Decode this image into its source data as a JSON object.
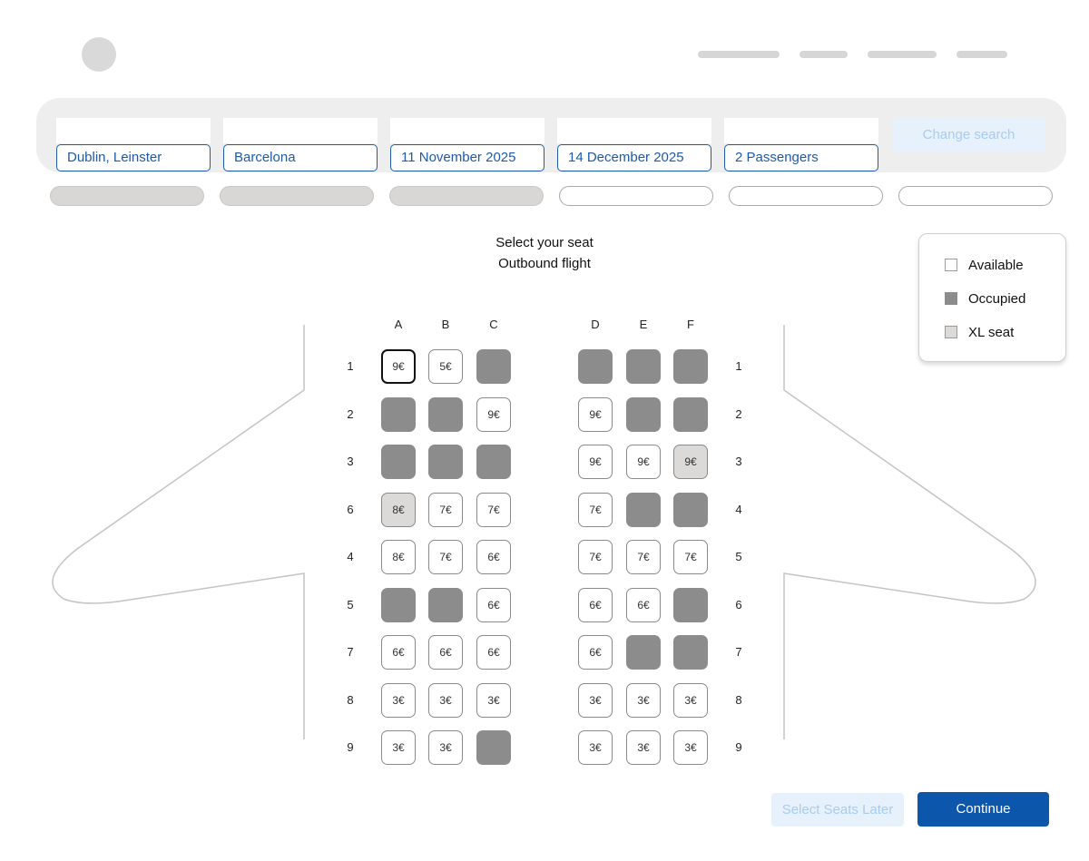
{
  "search": {
    "origin": "Dublin, Leinster",
    "destination": "Barcelona",
    "depart_date": "11 November 2025",
    "return_date": "14 December 2025",
    "passengers": "2 Passengers",
    "change_label": "Change search"
  },
  "heading": {
    "title": "Select your seat",
    "subtitle": "Outbound flight"
  },
  "legend": [
    {
      "label": "Available",
      "state": "available"
    },
    {
      "label": "Occupied",
      "state": "occupied"
    },
    {
      "label": "XL seat",
      "state": "xl"
    }
  ],
  "seatmap": {
    "columns": [
      "A",
      "B",
      "C",
      "D",
      "E",
      "F"
    ],
    "rows": [
      {
        "left_label": "1",
        "right_label": "1",
        "seats": [
          {
            "state": "available",
            "price": "9€",
            "selected": true
          },
          {
            "state": "available",
            "price": "5€"
          },
          {
            "state": "occupied",
            "price": ""
          },
          {
            "state": "occupied",
            "price": ""
          },
          {
            "state": "occupied",
            "price": ""
          },
          {
            "state": "occupied",
            "price": ""
          }
        ]
      },
      {
        "left_label": "2",
        "right_label": "2",
        "seats": [
          {
            "state": "occupied",
            "price": ""
          },
          {
            "state": "occupied",
            "price": ""
          },
          {
            "state": "available",
            "price": "9€"
          },
          {
            "state": "available",
            "price": "9€"
          },
          {
            "state": "occupied",
            "price": ""
          },
          {
            "state": "occupied",
            "price": ""
          }
        ]
      },
      {
        "left_label": "3",
        "right_label": "3",
        "seats": [
          {
            "state": "occupied",
            "price": ""
          },
          {
            "state": "occupied",
            "price": ""
          },
          {
            "state": "occupied",
            "price": ""
          },
          {
            "state": "available",
            "price": "9€"
          },
          {
            "state": "available",
            "price": "9€"
          },
          {
            "state": "xl",
            "price": "9€"
          }
        ]
      },
      {
        "left_label": "6",
        "right_label": "4",
        "seats": [
          {
            "state": "xl",
            "price": "8€"
          },
          {
            "state": "available",
            "price": "7€"
          },
          {
            "state": "available",
            "price": "7€"
          },
          {
            "state": "available",
            "price": "7€"
          },
          {
            "state": "occupied",
            "price": ""
          },
          {
            "state": "occupied",
            "price": ""
          }
        ]
      },
      {
        "left_label": "4",
        "right_label": "5",
        "seats": [
          {
            "state": "available",
            "price": "8€"
          },
          {
            "state": "available",
            "price": "7€"
          },
          {
            "state": "available",
            "price": "6€"
          },
          {
            "state": "available",
            "price": "7€"
          },
          {
            "state": "available",
            "price": "7€"
          },
          {
            "state": "available",
            "price": "7€"
          }
        ]
      },
      {
        "left_label": "5",
        "right_label": "6",
        "seats": [
          {
            "state": "occupied",
            "price": ""
          },
          {
            "state": "occupied",
            "price": ""
          },
          {
            "state": "available",
            "price": "6€"
          },
          {
            "state": "available",
            "price": "6€"
          },
          {
            "state": "available",
            "price": "6€"
          },
          {
            "state": "occupied",
            "price": ""
          }
        ]
      },
      {
        "left_label": "7",
        "right_label": "7",
        "seats": [
          {
            "state": "available",
            "price": "6€"
          },
          {
            "state": "available",
            "price": "6€"
          },
          {
            "state": "available",
            "price": "6€"
          },
          {
            "state": "available",
            "price": "6€"
          },
          {
            "state": "occupied",
            "price": ""
          },
          {
            "state": "occupied",
            "price": ""
          }
        ]
      },
      {
        "left_label": "8",
        "right_label": "8",
        "seats": [
          {
            "state": "available",
            "price": "3€"
          },
          {
            "state": "available",
            "price": "3€"
          },
          {
            "state": "available",
            "price": "3€"
          },
          {
            "state": "available",
            "price": "3€"
          },
          {
            "state": "available",
            "price": "3€"
          },
          {
            "state": "available",
            "price": "3€"
          }
        ]
      },
      {
        "left_label": "9",
        "right_label": "9",
        "seats": [
          {
            "state": "available",
            "price": "3€"
          },
          {
            "state": "available",
            "price": "3€"
          },
          {
            "state": "occupied",
            "price": ""
          },
          {
            "state": "available",
            "price": "3€"
          },
          {
            "state": "available",
            "price": "3€"
          },
          {
            "state": "available",
            "price": "3€"
          }
        ]
      }
    ]
  },
  "actions": {
    "later_label": "Select Seats Later",
    "continue_label": "Continue"
  },
  "colors": {
    "brand_blue": "#0c56ab",
    "field_blue": "#1e5aa8",
    "occupied": "#8c8c8c",
    "xl": "#dcd9d9"
  }
}
